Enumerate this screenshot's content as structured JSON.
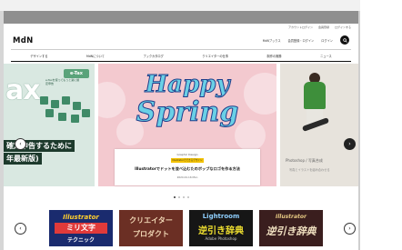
{
  "header": {
    "util_links": [
      "アカウントログイン",
      "会員登録",
      "ログインする"
    ],
    "logo": "MdN",
    "shop_label": "MdNブックス",
    "member_label": "会員登録・ログイン",
    "login_label": "ログイン"
  },
  "nav": {
    "items": [
      "デザインする",
      "MdNについて",
      "ブックカタログ",
      "クリエイターの仕事",
      "制作の実務",
      "ニュース"
    ]
  },
  "hero": {
    "left": {
      "badge": "e-Tax",
      "big": "ax",
      "sub": "e-Taxを使ってもっと楽に確定申告",
      "caption1": "確定申告するために",
      "caption2": "年最新版)"
    },
    "center": {
      "line1": "Happy",
      "line2": "Spring",
      "card_category": "Graphic Design",
      "card_tag": "Illustratorでできるデザイン",
      "card_title": "Illustratorでドットを並べ込むたのボッブなロゴを作る方法",
      "card_date": "2024.01.16 Mon"
    },
    "right": {
      "caption": "Photoshop / 写真合成",
      "caption2": "写真とイラストを組み合わせる"
    },
    "prev_icon": "chevron-left-icon",
    "next_icon": "chevron-right-icon",
    "dots_count": 4
  },
  "thumbs": [
    {
      "line1": "Illustrator",
      "line2": "ミリ文字",
      "line3": "テクニック"
    },
    {
      "line1": "クリエイター",
      "line2": "プロダクト"
    },
    {
      "line1": "Lightroom",
      "line2": "逆引き辞典",
      "line3": "Adobe Photoshop"
    },
    {
      "line1": "Illustrator",
      "line2": "逆引き辞典"
    }
  ]
}
